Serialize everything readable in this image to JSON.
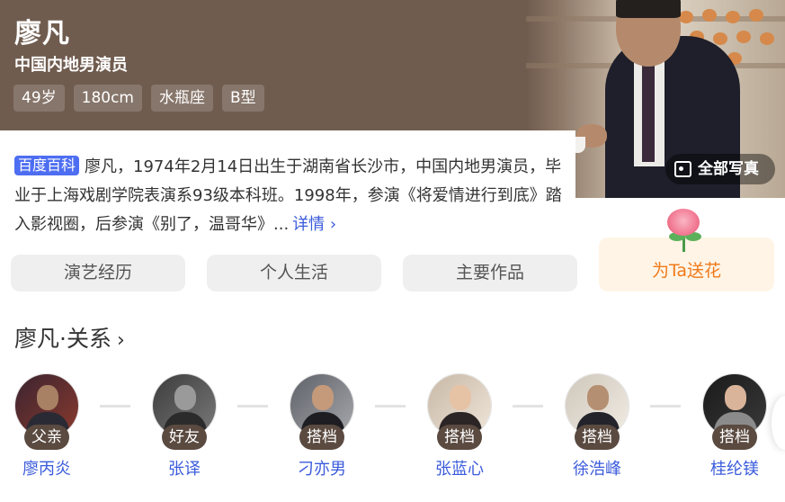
{
  "profile": {
    "name": "廖凡",
    "subtitle": "中国内地男演员",
    "tags": [
      "49岁",
      "180cm",
      "水瓶座",
      "B型"
    ],
    "all_photos_label": "全部写真"
  },
  "intro": {
    "badge": "百度百科",
    "text": "廖凡，1974年2月14日出生于湖南省长沙市，中国内地男演员，毕业于上海戏剧学院表演系93级本科班。1998年，参演《将爱情进行到底》踏入影视圈，后参演《别了，温哥华》...",
    "more_label": "详情",
    "more_chevron": "›"
  },
  "tabs": [
    "演艺经历",
    "个人生活",
    "主要作品"
  ],
  "flower": {
    "label": "为Ta送花",
    "icon": "rose-icon"
  },
  "relations": {
    "title": "廖凡·关系",
    "chevron": "›",
    "people": [
      {
        "role": "父亲",
        "name": "廖丙炎"
      },
      {
        "role": "好友",
        "name": "张译"
      },
      {
        "role": "搭档",
        "name": "刁亦男"
      },
      {
        "role": "搭档",
        "name": "张蓝心"
      },
      {
        "role": "搭档",
        "name": "徐浩峰"
      },
      {
        "role": "搭档",
        "name": "桂纶镁"
      }
    ]
  },
  "colors": {
    "banner": "#705c4f",
    "link": "#3b5bdb",
    "badge": "#4e6ef2",
    "flower_text": "#f07a1a"
  }
}
